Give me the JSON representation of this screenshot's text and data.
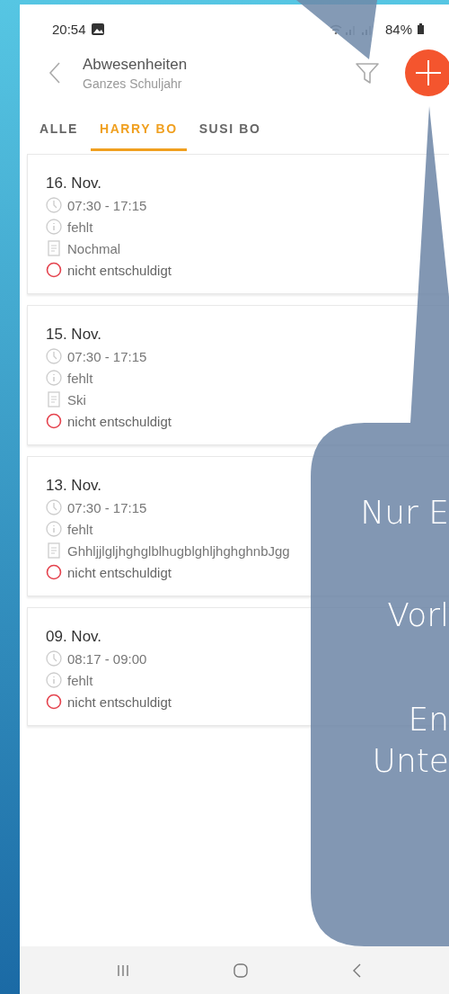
{
  "status_bar": {
    "time": "20:54",
    "battery": "84%"
  },
  "header": {
    "title": "Abwesenheiten",
    "subtitle": "Ganzes Schuljahr"
  },
  "tabs": [
    {
      "label": "ALLE",
      "selected": false
    },
    {
      "label": "HARRY BO",
      "selected": true
    },
    {
      "label": "SUSI BO",
      "selected": false
    }
  ],
  "absences": [
    {
      "date": "16. Nov.",
      "rows": [
        {
          "kind": "time",
          "text": "07:30 - 17:15"
        },
        {
          "kind": "type",
          "text": "fehlt"
        },
        {
          "kind": "note",
          "text": "Nochmal"
        },
        {
          "kind": "status",
          "text": "nicht entschuldigt"
        }
      ]
    },
    {
      "date": "15. Nov.",
      "rows": [
        {
          "kind": "time",
          "text": "07:30 - 17:15"
        },
        {
          "kind": "type",
          "text": "fehlt"
        },
        {
          "kind": "note",
          "text": "Ski"
        },
        {
          "kind": "status",
          "text": "nicht entschuldigt"
        }
      ]
    },
    {
      "date": "13. Nov.",
      "rows": [
        {
          "kind": "time",
          "text": "07:30 - 17:15"
        },
        {
          "kind": "type",
          "text": "fehlt"
        },
        {
          "kind": "note",
          "text": "GhhljjlgljhghglblhugblghljhghghnbJgg"
        },
        {
          "kind": "status",
          "text": "nicht entschuldigt"
        }
      ]
    },
    {
      "date": "09. Nov.",
      "rows": [
        {
          "kind": "time",
          "text": "08:17 - 09:00"
        },
        {
          "kind": "type",
          "text": "fehlt"
        },
        {
          "kind": "status",
          "text": "nicht entschuldigt"
        }
      ]
    }
  ],
  "callout": {
    "lines": [
      "Nur E",
      "Vorl",
      "En",
      "Unte"
    ]
  }
}
